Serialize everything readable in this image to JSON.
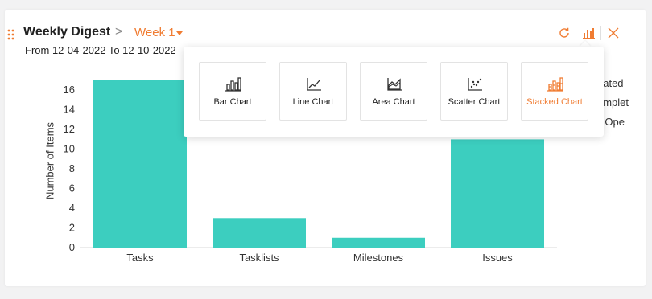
{
  "widget": {
    "title": "Weekly Digest",
    "breadcrumb_sep": ">",
    "week": "Week 1",
    "date_range": "From 12-04-2022 To 12-10-2022"
  },
  "toolbar": {
    "refresh_icon": "refresh-icon",
    "chart_type_icon": "bar-chart-icon",
    "close_icon": "close-icon"
  },
  "legend": [
    "eated",
    "omplet",
    "ll Ope"
  ],
  "chart_types": [
    {
      "label": "Bar Chart",
      "icon": "bar-chart-icon",
      "active": false
    },
    {
      "label": "Line Chart",
      "icon": "line-chart-icon",
      "active": false
    },
    {
      "label": "Area Chart",
      "icon": "area-chart-icon",
      "active": false
    },
    {
      "label": "Scatter Chart",
      "icon": "scatter-chart-icon",
      "active": false
    },
    {
      "label": "Stacked Chart",
      "icon": "stacked-chart-icon",
      "active": true
    }
  ],
  "colors": {
    "accent": "#f07c32",
    "bar": "#3ccebf"
  },
  "chart_data": {
    "type": "bar",
    "categories": [
      "Tasks",
      "Tasklists",
      "Milestones",
      "Issues"
    ],
    "values": [
      17,
      3,
      1,
      11
    ],
    "ylabel": "Number of Items",
    "xlabel": "",
    "ylim": [
      0,
      17
    ],
    "yticks": [
      0,
      2,
      4,
      6,
      8,
      10,
      12,
      14,
      16
    ],
    "grid": false
  }
}
